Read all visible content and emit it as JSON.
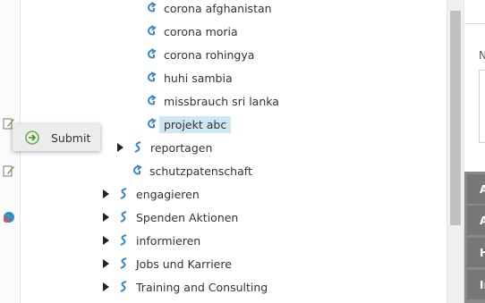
{
  "tree": {
    "items": [
      {
        "label": "corona afghanistan",
        "expandable": false,
        "selected": false
      },
      {
        "label": "corona moria",
        "expandable": false,
        "selected": false
      },
      {
        "label": "corona rohingya",
        "expandable": false,
        "selected": false
      },
      {
        "label": "huhi sambia",
        "expandable": false,
        "selected": false
      },
      {
        "label": "missbrauch sri lanka",
        "expandable": false,
        "selected": false
      },
      {
        "label": "projekt abc",
        "expandable": false,
        "selected": true
      },
      {
        "label": "reportagen",
        "expandable": true,
        "selected": false
      },
      {
        "label": "schutzpatenschaft",
        "expandable": false,
        "selected": false
      },
      {
        "label": "engagieren",
        "expandable": true,
        "selected": false
      },
      {
        "label": "Spenden Aktionen",
        "expandable": true,
        "selected": false
      },
      {
        "label": "informieren",
        "expandable": true,
        "selected": false
      },
      {
        "label": "Jobs und Karriere",
        "expandable": true,
        "selected": false
      },
      {
        "label": "Training and Consulting",
        "expandable": true,
        "selected": false
      }
    ]
  },
  "context_menu": {
    "submit_label": "Submit"
  },
  "right_panel": {
    "field_label": "N",
    "bars": [
      "A",
      "A",
      "H",
      "In"
    ]
  },
  "colors": {
    "selection": "#cfe6f3",
    "node_icon": "#3a86c6",
    "right_bar": "#777777"
  },
  "icons": {
    "node": "link-icon",
    "expand": "triangle-right-icon",
    "submit": "arrow-circle-right-icon"
  }
}
